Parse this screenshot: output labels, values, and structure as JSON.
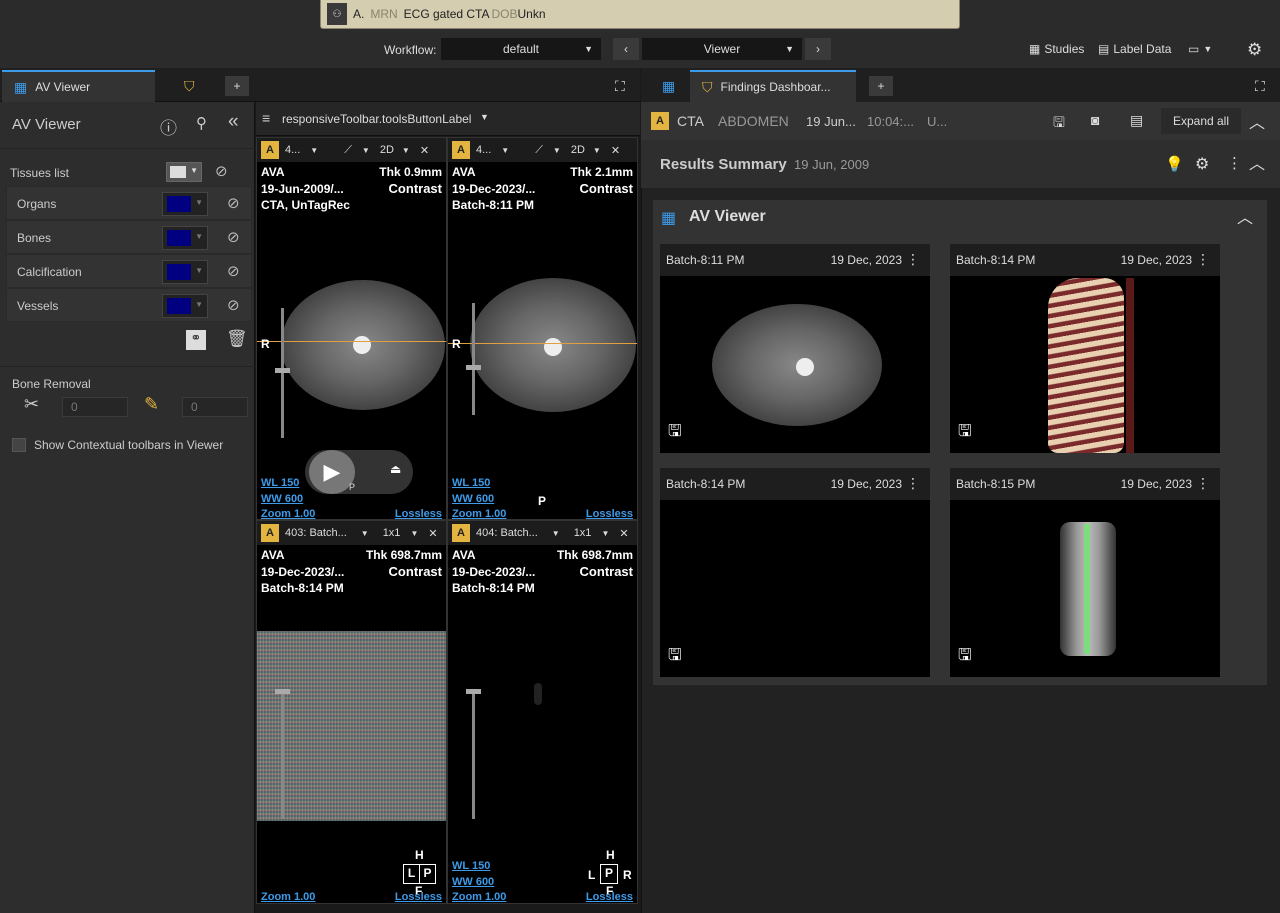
{
  "patient": {
    "initial": "A.",
    "mrn_label": "MRN",
    "study": "ECG gated CTA",
    "dob_label": "DOB",
    "dob_value": "Unkn"
  },
  "top": {
    "workflow_label": "Workflow:",
    "workflow_value": "default",
    "view_value": "Viewer",
    "studies": "Studies",
    "label_data": "Label Data"
  },
  "left_tabs": {
    "av_viewer": "AV Viewer"
  },
  "sidebar": {
    "title": "AV Viewer",
    "tissues_label": "Tissues list",
    "tissues": [
      {
        "name": "Organs",
        "color": "#000080"
      },
      {
        "name": "Bones",
        "color": "#000080"
      },
      {
        "name": "Calcification",
        "color": "#000080"
      },
      {
        "name": "Vessels",
        "color": "#000080"
      }
    ],
    "bone_removal_label": "Bone Removal",
    "bone_removal_value1": "0",
    "bone_removal_value2": "0",
    "contextual_label": "Show Contextual toolbars in Viewer"
  },
  "viewer_toolbar": {
    "label": "responsiveToolbar.toolsButtonLabel"
  },
  "viewports": [
    {
      "series": "4...",
      "mode": "2D",
      "name": "AVA",
      "date": "19-Jun-2009/...",
      "desc": "CTA, UnTagRec",
      "thk": "Thk 0.9mm",
      "contrast": "Contrast",
      "wl": "WL 150",
      "ww": "WW 600",
      "zoom": "Zoom 1.00",
      "comp": "Lossless",
      "orient_left": "R"
    },
    {
      "series": "4...",
      "mode": "2D",
      "name": "AVA",
      "date": "19-Dec-2023/...",
      "desc": "Batch-8:11 PM",
      "thk": "Thk 2.1mm",
      "contrast": "Contrast",
      "wl": "WL 150",
      "ww": "WW 600",
      "zoom": "Zoom 1.00",
      "comp": "Lossless",
      "orient_left": "R",
      "orient_bottom": "P"
    },
    {
      "series": "403: Batch...",
      "mode": "1x1",
      "name": "AVA",
      "date": "19-Dec-2023/...",
      "desc": "Batch-8:14 PM",
      "thk": "Thk 698.7mm",
      "contrast": "Contrast",
      "zoom": "Zoom 1.00",
      "comp": "Lossless",
      "orient_top": "H",
      "orient_l": "L",
      "orient_p": "P",
      "orient_f": "F"
    },
    {
      "series": "404: Batch...",
      "mode": "1x1",
      "name": "AVA",
      "date": "19-Dec-2023/...",
      "desc": "Batch-8:14 PM",
      "thk": "Thk 698.7mm",
      "contrast": "Contrast",
      "wl": "WL 150",
      "ww": "WW 600",
      "zoom": "Zoom 1.00",
      "comp": "Lossless",
      "orient_top": "H",
      "orient_l": "L",
      "orient_p": "P",
      "orient_r": "R",
      "orient_f": "F"
    }
  ],
  "play_p": "P",
  "right_tabs": {
    "findings": "Findings Dashboar..."
  },
  "study_bar": {
    "modality": "CTA",
    "body_part": "ABDOMEN",
    "date": "19 Jun...",
    "time": "10:04:...",
    "extra": "U...",
    "expand_all": "Expand all"
  },
  "results": {
    "title": "Results Summary",
    "date": "19 Jun, 2009"
  },
  "av_card": {
    "title": "AV Viewer",
    "thumbs": [
      {
        "title": "Batch-8:11 PM",
        "date": "19 Dec, 2023"
      },
      {
        "title": "Batch-8:14 PM",
        "date": "19 Dec, 2023"
      },
      {
        "title": "Batch-8:14 PM",
        "date": "19 Dec, 2023"
      },
      {
        "title": "Batch-8:15 PM",
        "date": "19 Dec, 2023"
      }
    ]
  }
}
